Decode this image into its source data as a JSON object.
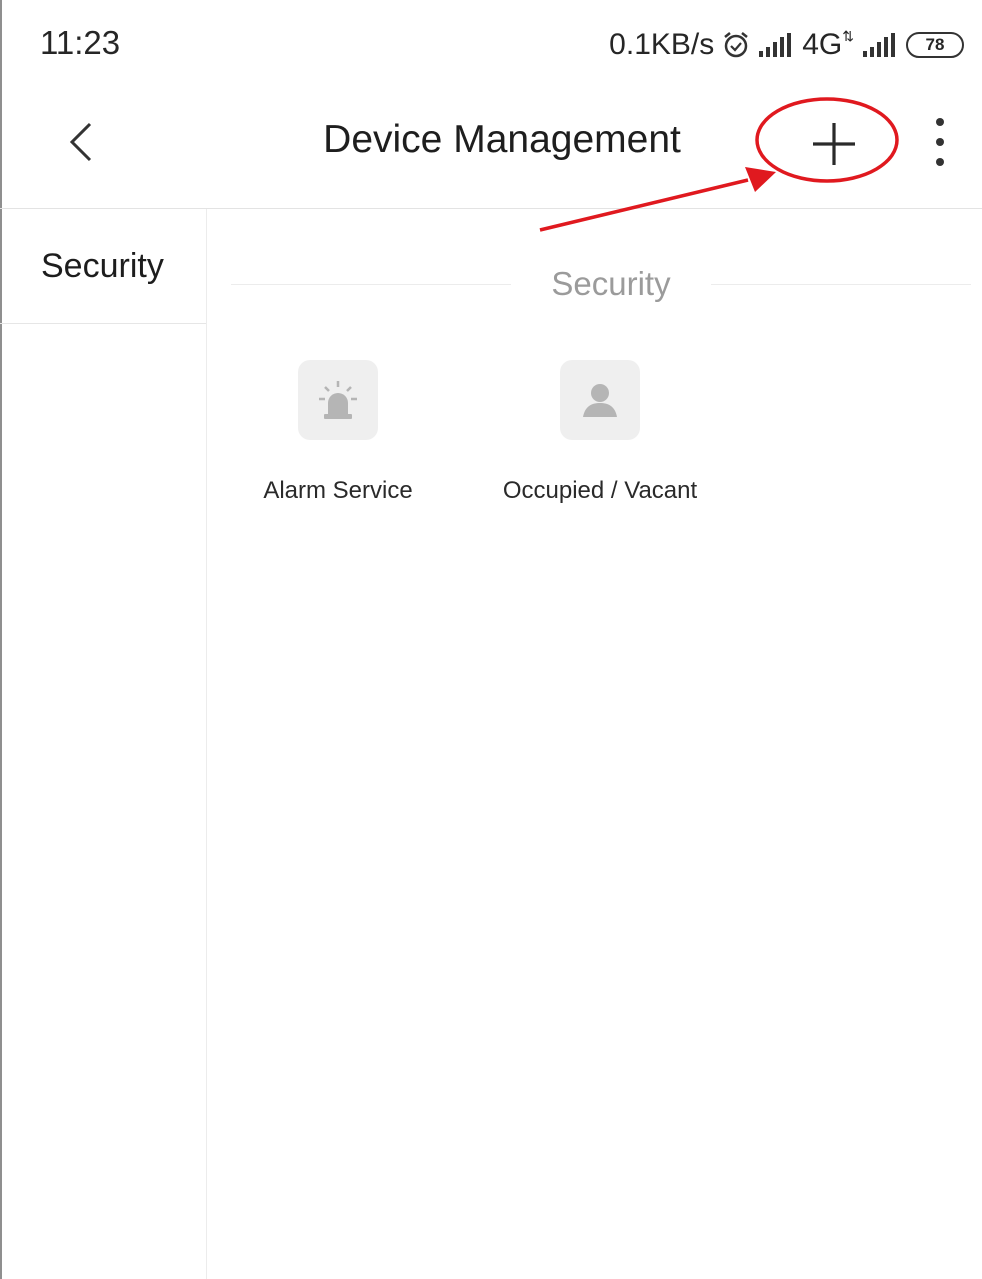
{
  "status_bar": {
    "time": "11:23",
    "net_speed": "0.1KB/s",
    "network_type": "4G",
    "battery_level": "78",
    "icons": [
      "alarm-clock-icon",
      "signal-icon",
      "signal-icon"
    ]
  },
  "header": {
    "title": "Device Management",
    "icons": [
      "back-arrow-icon",
      "plus-icon",
      "more-vert-icon"
    ]
  },
  "sidebar": {
    "items": [
      {
        "label": "Security",
        "selected": true
      }
    ]
  },
  "main": {
    "section_title": "Security",
    "tiles": [
      {
        "label": "Alarm Service",
        "icon": "siren-icon"
      },
      {
        "label": "Occupied / Vacant",
        "icon": "person-icon"
      }
    ]
  },
  "annotation": {
    "color": "#e0191f",
    "target": "plus-button"
  },
  "colors": {
    "background": "#ffffff",
    "divider": "#e6e6e6",
    "section_title": "#9b9b9b",
    "tile_bg": "#efefef",
    "annotation": "#e0191f"
  }
}
